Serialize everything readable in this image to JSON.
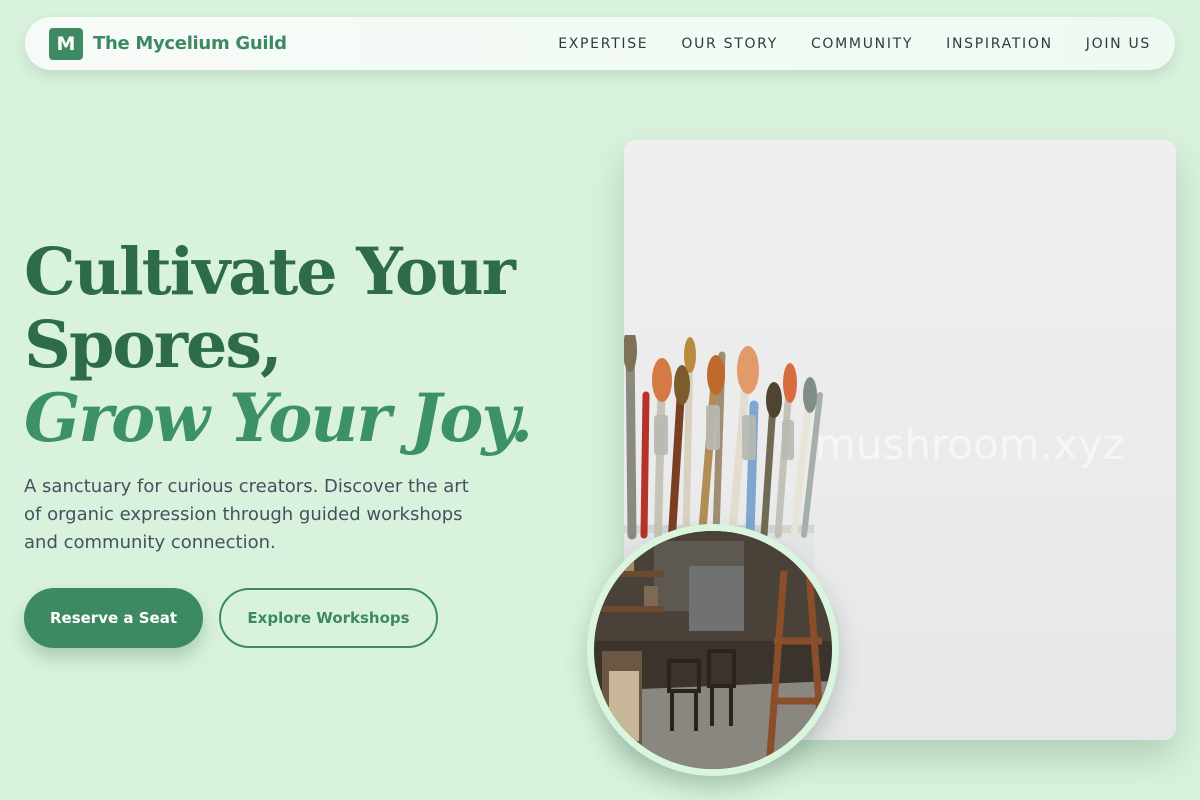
{
  "brand": {
    "mark": "M",
    "name": "The Mycelium Guild"
  },
  "nav": {
    "links": [
      "EXPERTISE",
      "OUR STORY",
      "COMMUNITY",
      "INSPIRATION",
      "JOIN US"
    ]
  },
  "hero": {
    "headline_line1": "Cultivate Your",
    "headline_line2": "Spores,",
    "headline_accent": "Grow Your Joy.",
    "subtitle": "A sanctuary for curious creators. Discover the art of organic expression through guided workshops and community connection.",
    "primary_cta": "Reserve a Seat",
    "secondary_cta": "Explore Workshops"
  },
  "media": {
    "watermark": "mushroom.xyz",
    "main_image": "paintbrushes-jar",
    "inset_image": "art-studio-interior"
  },
  "colors": {
    "background": "#d9f2dd",
    "brand_green": "#3d8a62",
    "headline_green": "#2d6b49",
    "text_dark": "#2f3a44"
  }
}
